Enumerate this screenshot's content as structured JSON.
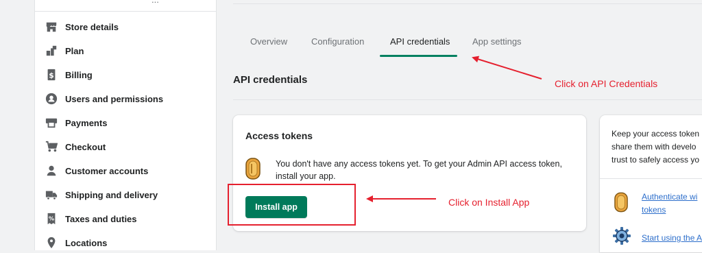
{
  "sidebar": {
    "top_fragment": "...",
    "items": [
      {
        "label": "Store details",
        "icon": "store-icon"
      },
      {
        "label": "Plan",
        "icon": "plan-icon"
      },
      {
        "label": "Billing",
        "icon": "billing-icon"
      },
      {
        "label": "Users and permissions",
        "icon": "user-circle-icon"
      },
      {
        "label": "Payments",
        "icon": "payments-icon"
      },
      {
        "label": "Checkout",
        "icon": "cart-icon"
      },
      {
        "label": "Customer accounts",
        "icon": "customer-icon"
      },
      {
        "label": "Shipping and delivery",
        "icon": "truck-icon"
      },
      {
        "label": "Taxes and duties",
        "icon": "taxes-icon"
      },
      {
        "label": "Locations",
        "icon": "location-pin-icon"
      }
    ]
  },
  "tabs": [
    {
      "label": "Overview",
      "active": false
    },
    {
      "label": "Configuration",
      "active": false
    },
    {
      "label": "API credentials",
      "active": true
    },
    {
      "label": "App settings",
      "active": false
    }
  ],
  "section": {
    "title": "API credentials"
  },
  "access_tokens": {
    "title": "Access tokens",
    "message": "You don't have any access tokens yet. To get your Admin API access token, install your app.",
    "button": "Install app"
  },
  "right_card": {
    "lines": [
      "Keep your access token",
      "share them with develo",
      "trust to safely access yo"
    ],
    "link1_lines": [
      "Authenticate wi",
      "tokens"
    ],
    "link2": "Start using the A"
  },
  "annotations": {
    "api_credentials_note": "Click on API Credentials",
    "install_app_note": "Click on Install App"
  },
  "colors": {
    "accent": "#008060",
    "button": "#007a5a",
    "annotation": "#e5202e",
    "link": "#2c6ecb"
  }
}
